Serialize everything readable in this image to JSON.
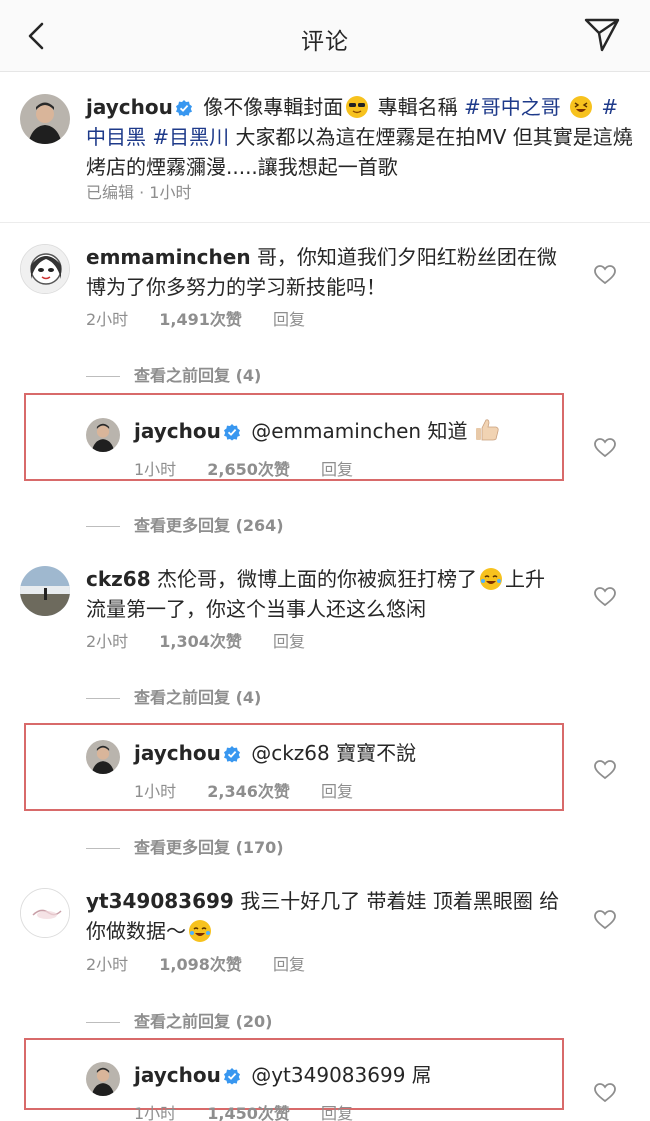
{
  "header": {
    "title": "评论"
  },
  "post": {
    "username": "jaychou",
    "text_segments": [
      {
        "t": "像不像專輯封面",
        "tag": false
      },
      {
        "t": "😎",
        "emoji": "sunglasses"
      },
      {
        "t": " 專輯名稱 ",
        "tag": false
      },
      {
        "t": "#哥中之哥",
        "tag": true
      },
      {
        "t": " 😆 ",
        "emoji": "laughing"
      },
      {
        "t": "#中目黑",
        "tag": true
      },
      {
        "t": " ",
        "tag": false
      },
      {
        "t": "#目黑川",
        "tag": true
      },
      {
        "t": " 大家都以為這在煙霧是在拍MV 但其實是這燒烤店的煙霧瀰漫.....讓我想起一首歌",
        "tag": false
      }
    ],
    "line1": "像不像專輯封面",
    "line1b": "專輯名稱",
    "tag1": "#哥中之哥",
    "tag2": "#",
    "line2_tag1": "中目黑",
    "line2_tag2": "#目黑川",
    "line2_rest": " 大家都以為這在煙霧是在拍MV 但其實是這",
    "line3": "燒烤店的煙霧瀰漫.....讓我想起一首歌",
    "meta": "已编辑 · 1小时"
  },
  "comments": [
    {
      "username": "emmaminchen",
      "line1": "哥，你知道我们夕阳红粉丝团在微",
      "line2": "博为了你多努力的学习新技能吗！",
      "time": "2小时",
      "likes": "1,491次赞",
      "reply": "回复",
      "view_prev": "查看之前回复 (4)",
      "jay_reply": {
        "username": "jaychou",
        "mention": "@emmaminchen",
        "text": "知道",
        "time": "1小时",
        "likes": "2,650次赞",
        "reply": "回复"
      },
      "view_more": "查看更多回复 (264)"
    },
    {
      "username": "ckz68",
      "line1": "杰伦哥，微博上面的你被疯狂打榜了",
      "line1_after": "上升",
      "line2": "流量第一了，你这个当事人还这么悠闲",
      "time": "2小时",
      "likes": "1,304次赞",
      "reply": "回复",
      "view_prev": "查看之前回复 (4)",
      "jay_reply": {
        "username": "jaychou",
        "mention": "@ckz68",
        "text": "寶寶不說",
        "time": "1小时",
        "likes": "2,346次赞",
        "reply": "回复"
      },
      "view_more": "查看更多回复 (170)"
    },
    {
      "username": "yt349083699",
      "line1": "我三十好几了 带着娃 顶着黑眼圈 给",
      "line2": "你做数据～",
      "time": "2小时",
      "likes": "1,098次赞",
      "reply": "回复",
      "view_prev": "查看之前回复 (20)",
      "jay_reply": {
        "username": "jaychou",
        "mention": "@yt349083699",
        "text": "屌",
        "time": "1小时",
        "likes": "1,450次赞",
        "reply": "回复"
      }
    }
  ],
  "colors": {
    "hashtag": "#1e3a8a",
    "verified": "#3897f0",
    "highlight_box": "#d86a6a",
    "meta": "#8e8e8e"
  }
}
